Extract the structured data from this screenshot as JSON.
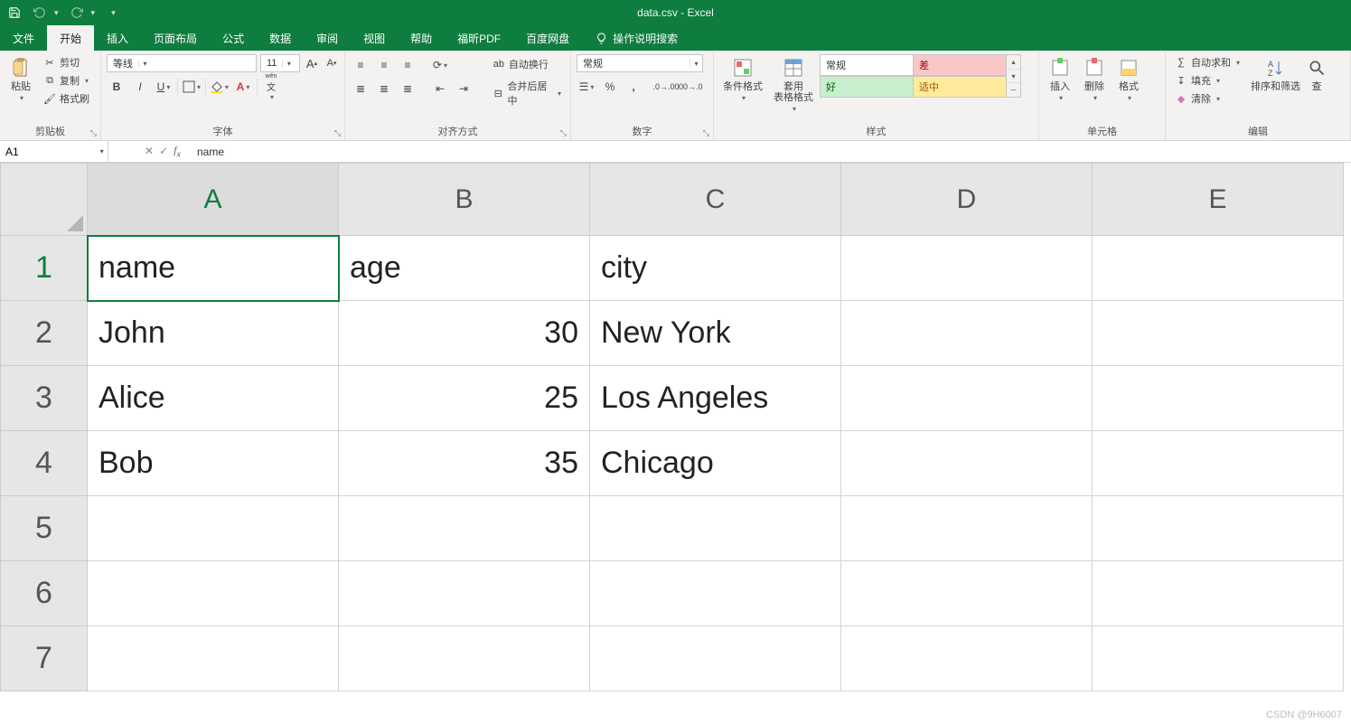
{
  "title": "data.csv  -  Excel",
  "tabs": {
    "file": "文件",
    "home": "开始",
    "insert": "插入",
    "layout": "页面布局",
    "formulas": "公式",
    "data": "数据",
    "review": "审阅",
    "view": "视图",
    "help": "帮助",
    "foxit": "福昕PDF",
    "baidu": "百度网盘",
    "tellme": "操作说明搜索"
  },
  "ribbon": {
    "clipboard": {
      "paste": "粘贴",
      "cut": "剪切",
      "copy": "复制",
      "painter": "格式刷",
      "label": "剪贴板"
    },
    "font": {
      "name": "等线",
      "size": "11",
      "ruby": "wén",
      "label": "字体"
    },
    "align": {
      "wrap": "自动换行",
      "merge": "合并后居中",
      "label": "对齐方式"
    },
    "number": {
      "format": "常规",
      "label": "数字"
    },
    "styles": {
      "cond": "条件格式",
      "table": "套用\n表格格式",
      "normal": "常规",
      "bad": "差",
      "good": "好",
      "neutral": "适中",
      "label": "样式"
    },
    "cells": {
      "insert": "插入",
      "delete": "删除",
      "format": "格式",
      "label": "单元格"
    },
    "editing": {
      "sum": "自动求和",
      "fill": "填充",
      "clear": "清除",
      "sort": "排序和筛选",
      "find": "查",
      "label": "编辑"
    }
  },
  "namebox": "A1",
  "formula": "name",
  "columns": [
    "A",
    "B",
    "C",
    "D",
    "E"
  ],
  "rows_visible": [
    "1",
    "2",
    "3",
    "4",
    "5",
    "6",
    "7"
  ],
  "chart_data": {
    "type": "table",
    "columns": [
      "name",
      "age",
      "city"
    ],
    "rows": [
      {
        "name": "John",
        "age": 30,
        "city": "New York"
      },
      {
        "name": "Alice",
        "age": 25,
        "city": "Los Angeles"
      },
      {
        "name": "Bob",
        "age": 35,
        "city": "Chicago"
      }
    ]
  },
  "selected_cell": "A1",
  "watermark": "CSDN @9H6007"
}
